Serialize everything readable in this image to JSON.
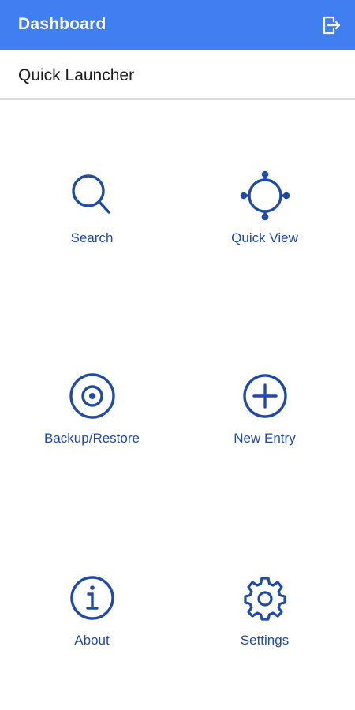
{
  "app_bar": {
    "title": "Dashboard",
    "logout_icon": "logout-icon",
    "background": "#3f7ff1"
  },
  "section": {
    "title": "Quick Launcher"
  },
  "accent": "#1f4aa5",
  "tiles": [
    {
      "label": "Search",
      "icon": "search-icon"
    },
    {
      "label": "Quick View",
      "icon": "crosshair-icon"
    },
    {
      "label": "Backup/Restore",
      "icon": "target-icon"
    },
    {
      "label": "New Entry",
      "icon": "plus-circle-icon"
    },
    {
      "label": "About",
      "icon": "info-icon"
    },
    {
      "label": "Settings",
      "icon": "gear-icon"
    }
  ]
}
